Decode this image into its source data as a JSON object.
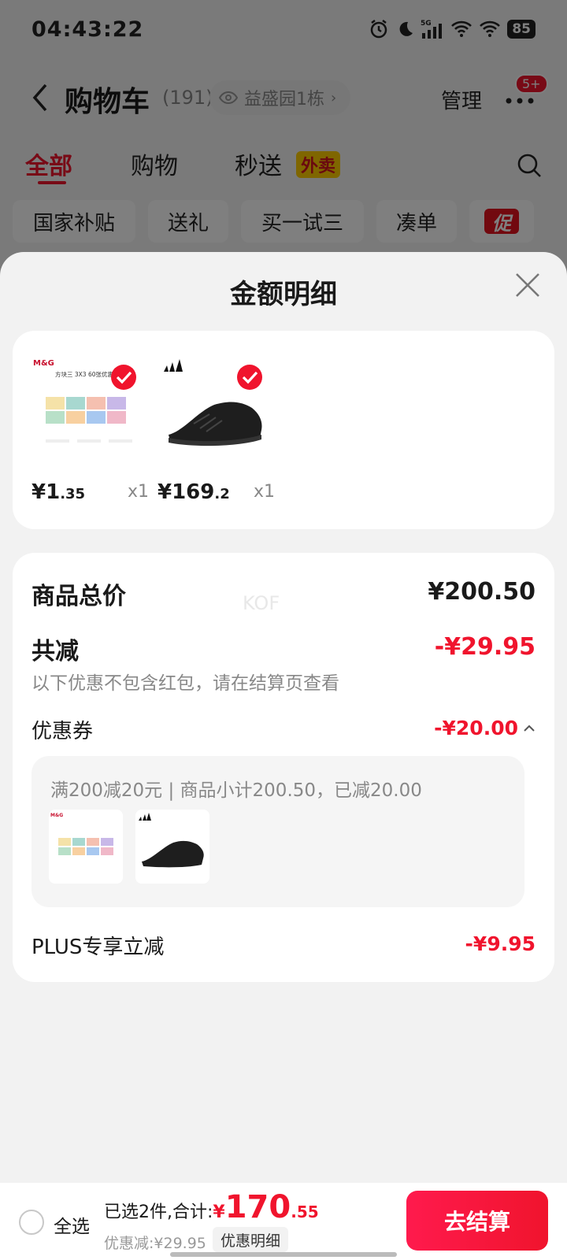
{
  "status_bar": {
    "time": "04:43:22",
    "network": "5G",
    "battery": "85",
    "icons": [
      "alarm-icon",
      "moon-icon",
      "signal-icon",
      "wifi-icon",
      "wifi-icon",
      "battery-icon"
    ]
  },
  "cart_header": {
    "title": "购物车",
    "count": "(191)",
    "address": "益盛园1栋",
    "manage": "管理",
    "badge": "5+"
  },
  "cart_tabs": [
    {
      "label": "全部",
      "active": true
    },
    {
      "label": "购物",
      "active": false
    },
    {
      "label": "秒送",
      "active": false,
      "badge": "外卖"
    }
  ],
  "chips": [
    {
      "label": "国家补贴"
    },
    {
      "label": "送礼"
    },
    {
      "label": "买一试三"
    },
    {
      "label": "凑单"
    },
    {
      "label": "促"
    }
  ],
  "sheet": {
    "title": "金额明细",
    "products": [
      {
        "name": "方块三 3X3 60张优惠",
        "brand": "M&G",
        "price_int": "¥1",
        "price_dec": ".35",
        "qty": "x1",
        "checked": true
      },
      {
        "name": "adidas",
        "price_int": "¥169",
        "price_dec": ".2",
        "qty": "x1",
        "checked": true
      }
    ],
    "details": {
      "subtotal_label": "商品总价",
      "subtotal_value": "¥200.50",
      "watermark": "KOF",
      "reduction_label": "共减",
      "reduction_value": "-¥29.95",
      "reduction_note": "以下优惠不包含红包，请在结算页查看",
      "coupon_label": "优惠券",
      "coupon_value": "-¥20.00",
      "coupon_text": "满200减20元 | 商品小计200.50，已减20.00",
      "plus_label": "PLUS专享立减",
      "plus_value": "-¥9.95"
    }
  },
  "bottom_bar": {
    "select_all": "全选",
    "total_label": "已选2件,合计:",
    "total_currency": "¥",
    "total_int": "170",
    "total_dec": ".55",
    "discount_text": "优惠减:¥29.95",
    "discount_detail_button": "优惠明细",
    "checkout": "去结算"
  },
  "colors": {
    "accent": "#f0142d",
    "waimai_badge": "#ffcd00"
  }
}
